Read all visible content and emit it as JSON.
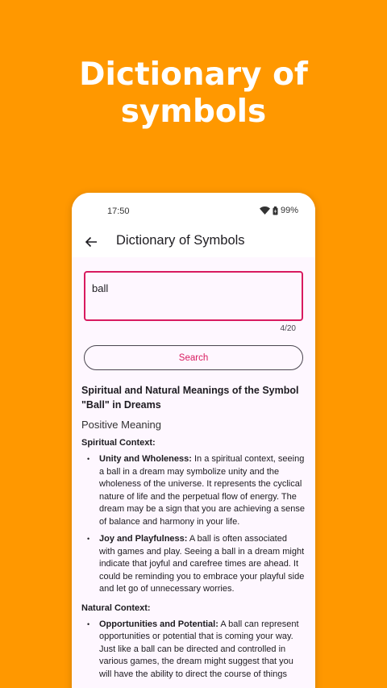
{
  "hero": {
    "line1": "Dictionary of",
    "line2": "symbols"
  },
  "status": {
    "time": "17:50",
    "battery": "99%"
  },
  "app_bar": {
    "title": "Dictionary of Symbols"
  },
  "search": {
    "value": "ball",
    "counter": "4/20",
    "button_label": "Search"
  },
  "result": {
    "title": "Spiritual and Natural Meanings of the Symbol \"Ball\" in Dreams",
    "section": "Positive Meaning",
    "contexts": [
      {
        "title": "Spiritual Context:",
        "items": [
          {
            "term": "Unity and Wholeness:",
            "text": " In a spiritual context, seeing a ball in a dream may symbolize unity and the wholeness of the universe. It represents the cyclical nature of life and the perpetual flow of energy. The dream may be a sign that you are achieving a sense of balance and harmony in your life."
          },
          {
            "term": "Joy and Playfulness:",
            "text": " A ball is often associated with games and play. Seeing a ball in a dream might indicate that joyful and carefree times are ahead. It could be reminding you to embrace your playful side and let go of unnecessary worries."
          }
        ]
      },
      {
        "title": "Natural Context:",
        "items": [
          {
            "term": "Opportunities and Potential:",
            "text": " A ball can represent opportunities or potential that is coming your way. Just like a ball can be directed and controlled in various games, the dream might suggest that you will have the ability to direct the course of things"
          }
        ]
      }
    ]
  }
}
